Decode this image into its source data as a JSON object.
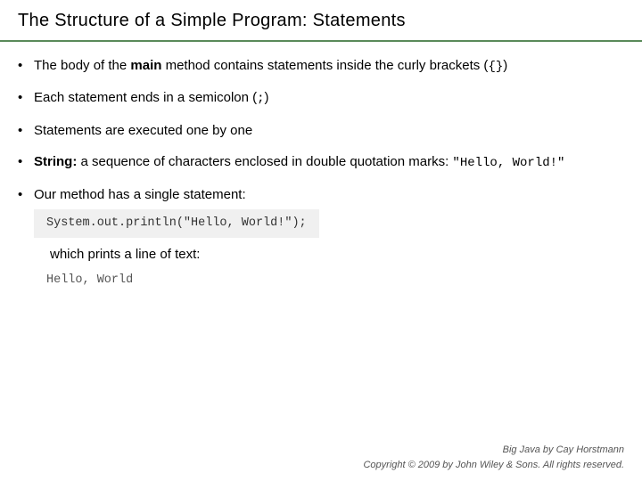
{
  "header": {
    "title": "The Structure of a Simple Program: Statements"
  },
  "bullets": [
    {
      "id": "bullet-1",
      "prefix": "The body of the ",
      "bold": "main",
      "suffix": " method contains statements inside the curly brackets (",
      "code": "{}",
      "end": ")"
    },
    {
      "id": "bullet-2",
      "text": "Each statement ends in a semicolon (",
      "code": ";",
      "end": ")"
    },
    {
      "id": "bullet-3",
      "text": "Statements are executed one by one"
    },
    {
      "id": "bullet-4",
      "bold": "String:",
      "suffix": " a sequence of characters enclosed in double quotation marks: ",
      "code": "\"Hello, World!\""
    },
    {
      "id": "bullet-5",
      "text": "Our method has a single statement:"
    }
  ],
  "code_block": "System.out.println(\"Hello, World!\");",
  "which_prints": "which prints a line of text:",
  "output_text": "Hello, World",
  "footer": {
    "line1": "Big Java by Cay Horstmann",
    "line2": "Copyright © 2009 by John Wiley & Sons.  All rights reserved."
  }
}
